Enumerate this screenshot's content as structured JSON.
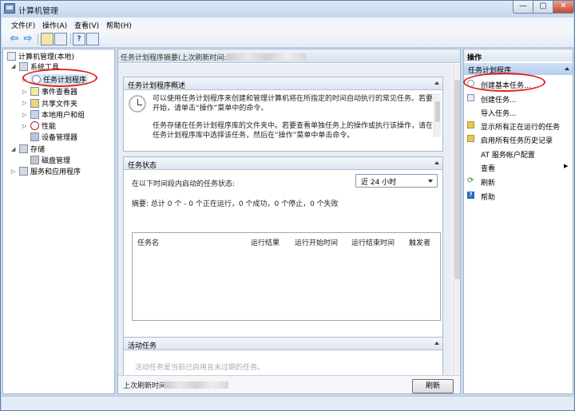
{
  "window": {
    "title": "计算机管理",
    "min": "—",
    "max": "▢",
    "close": "✕"
  },
  "menu": [
    "文件(F)",
    "操作(A)",
    "查看(V)",
    "帮助(H)"
  ],
  "toolbar": {
    "back": "⇦",
    "forward": "⇨",
    "help": "?"
  },
  "tree": {
    "root": "计算机管理(本地)",
    "system_tools": "系统工具",
    "task_scheduler": "任务计划程序",
    "event_viewer": "事件查看器",
    "shared_folders": "共享文件夹",
    "local_users": "本地用户和组",
    "performance": "性能",
    "device_manager": "设备管理器",
    "storage": "存储",
    "disk_management": "磁盘管理",
    "services_apps": "服务和应用程序"
  },
  "center": {
    "header": "任务计划程序摘要(上次刷新时间:",
    "overview": {
      "title": "任务计划程序概述",
      "p1_line1": "可以使用任务计划程序来创建和管理计算机将在所指定的时间自动执行的常见任务。若要",
      "p1_line2": "开始，请单击“操作”菜单中的命令。",
      "p2_line1": "任务存储在任务计划程序库的文件夹中。若要查看单独任务上的操作或执行该操作，请在",
      "p2_line2": "任务计划程序库中选择该任务，然后在“操作”菜单中单击命令。"
    },
    "status": {
      "title": "任务状态",
      "label": "在以下时间段内启动的任务状态:",
      "dropdown_value": "近 24 小时",
      "summary": "摘要: 总计 0 个 - 0 个正在运行，0 个成功，0 个停止，0 个失败",
      "columns": [
        "任务名",
        "运行结果",
        "运行开始时间",
        "运行结束时间",
        "触发者"
      ]
    },
    "active": {
      "title": "活动任务",
      "partial": "活动任务是当前已启用且未过期的任务。"
    },
    "footer_label": "上次刷新时间:",
    "refresh_button": "刷新"
  },
  "actions": {
    "header": "操作",
    "section": "任务计划程序",
    "items": [
      "创建基本任务...",
      "创建任务...",
      "导入任务...",
      "显示所有正在运行的任务",
      "启用所有任务历史记录",
      "AT 服务帐户配置",
      "查看",
      "刷新",
      "帮助"
    ]
  },
  "colors": {
    "highlight_oval": "#e0241c",
    "selected_section": "#b6cfee"
  }
}
